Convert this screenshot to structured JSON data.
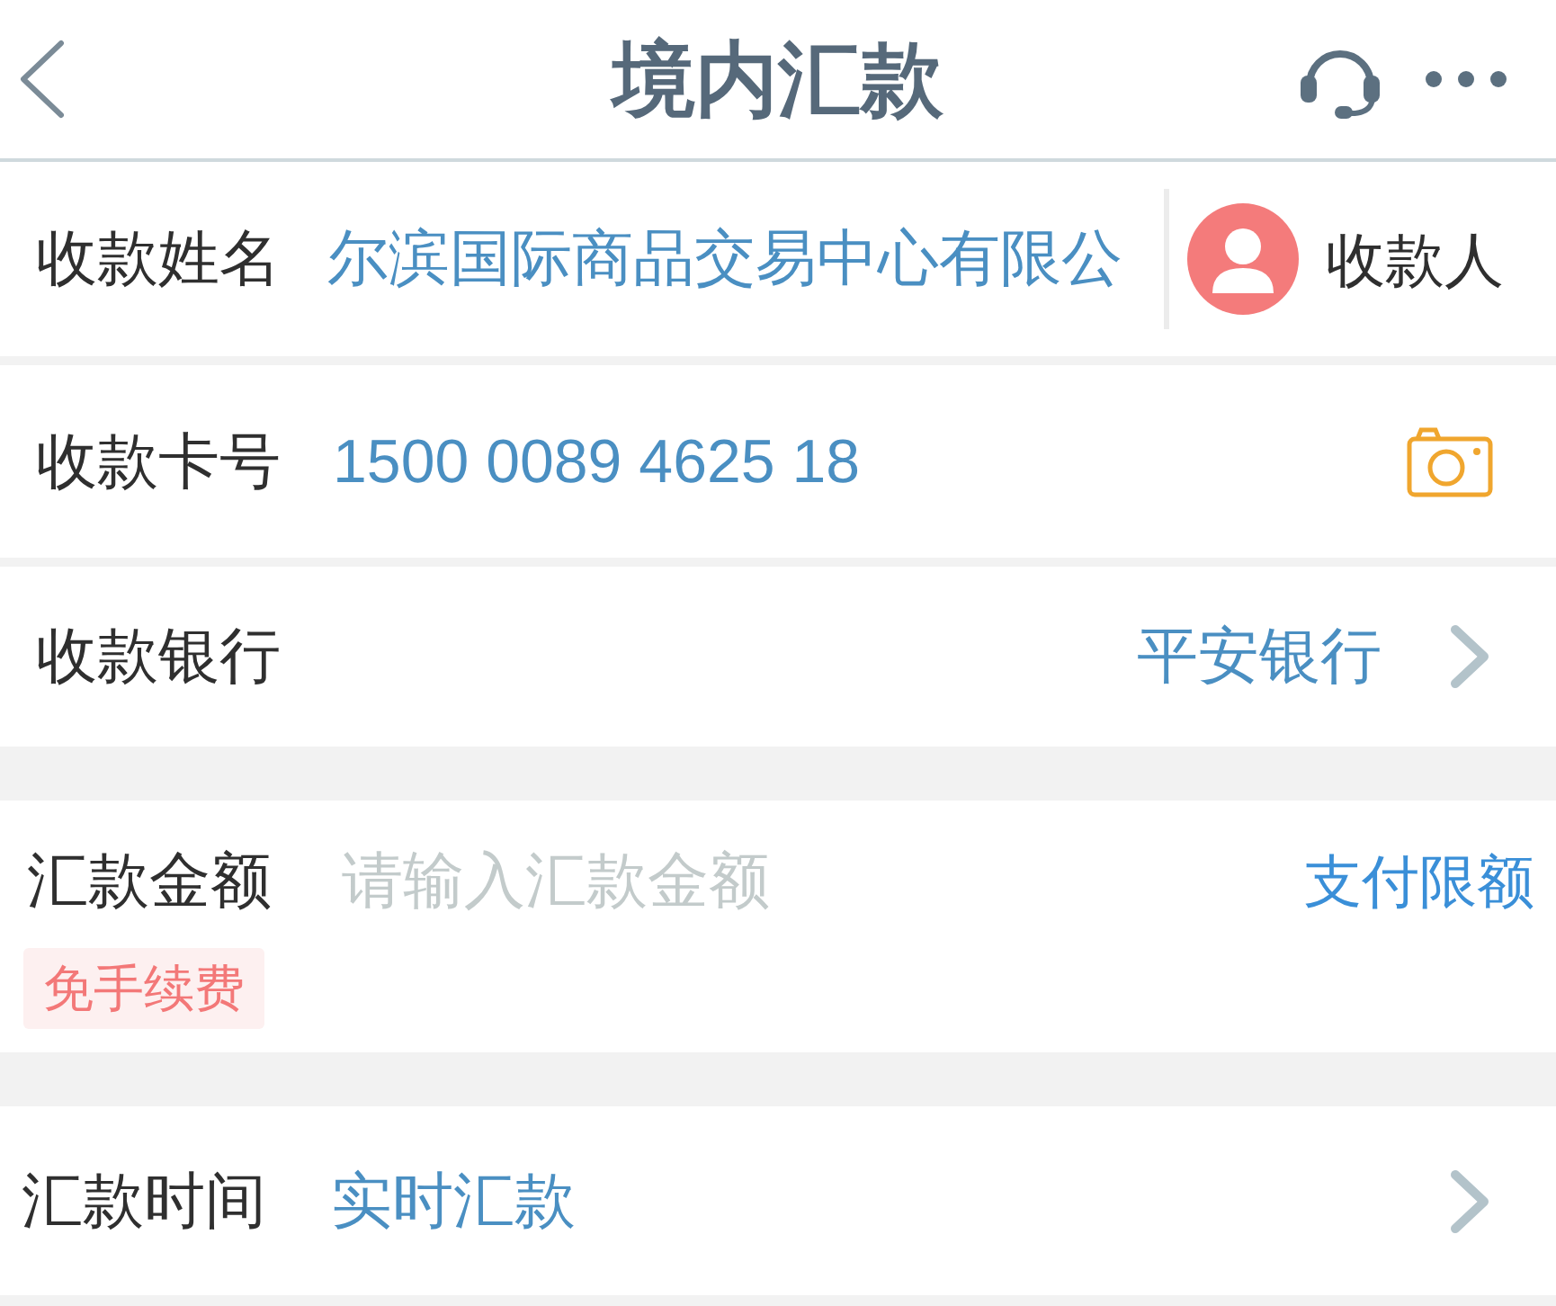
{
  "header": {
    "title": "境内汇款"
  },
  "sections": [
    {
      "rows": [
        {
          "kind": "payee",
          "label": "收款姓名",
          "value": "尔滨国际商品交易中心有限公",
          "button": "收款人"
        },
        {
          "kind": "card",
          "label": "收款卡号",
          "value": "1500 0089 4625 18"
        },
        {
          "kind": "bank",
          "label": "收款银行",
          "value": "平安银行"
        }
      ]
    },
    {
      "rows": [
        {
          "kind": "amount",
          "label": "汇款金额",
          "placeholder": "请输入汇款金额",
          "link": "支付限额",
          "badge": "免手续费"
        }
      ]
    },
    {
      "rows": [
        {
          "kind": "schedule",
          "label": "汇款时间",
          "value": "实时汇款"
        }
      ]
    }
  ]
}
